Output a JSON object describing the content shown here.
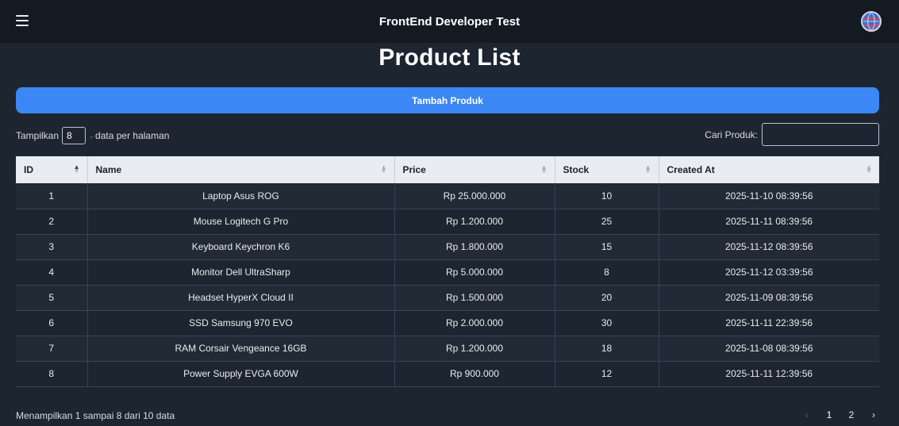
{
  "header": {
    "title": "FrontEnd Developer Test",
    "menu_icon": "hamburger-menu-icon",
    "avatar_icon": "globe-avatar-icon"
  },
  "page": {
    "title": "Product List",
    "add_button_label": "Tambah Produk"
  },
  "length_control": {
    "prefix": "Tampilkan",
    "value": "8",
    "suffix": "data per halaman"
  },
  "search": {
    "label": "Cari Produk:",
    "value": "",
    "placeholder": ""
  },
  "table": {
    "columns": [
      "ID",
      "Name",
      "Price",
      "Stock",
      "Created At"
    ],
    "sorted_column": "ID",
    "rows": [
      [
        "1",
        "Laptop Asus ROG",
        "Rp 25.000.000",
        "10",
        "2025-11-10 08:39:56"
      ],
      [
        "2",
        "Mouse Logitech G Pro",
        "Rp 1.200.000",
        "25",
        "2025-11-11 08:39:56"
      ],
      [
        "3",
        "Keyboard Keychron K6",
        "Rp 1.800.000",
        "15",
        "2025-11-12 08:39:56"
      ],
      [
        "4",
        "Monitor Dell UltraSharp",
        "Rp 5.000.000",
        "8",
        "2025-11-12 03:39:56"
      ],
      [
        "5",
        "Headset HyperX Cloud II",
        "Rp 1.500.000",
        "20",
        "2025-11-09 08:39:56"
      ],
      [
        "6",
        "SSD Samsung 970 EVO",
        "Rp 2.000.000",
        "30",
        "2025-11-11 22:39:56"
      ],
      [
        "7",
        "RAM Corsair Vengeance 16GB",
        "Rp 1.200.000",
        "18",
        "2025-11-08 08:39:56"
      ],
      [
        "8",
        "Power Supply EVGA 600W",
        "Rp 900.000",
        "12",
        "2025-11-11 12:39:56"
      ]
    ]
  },
  "footer": {
    "info": "Menampilkan 1 sampai 8 dari 10 data",
    "pagination": {
      "prev": "‹",
      "pages": [
        "1",
        "2"
      ],
      "current": "1",
      "next": "›"
    }
  },
  "colors": {
    "background": "#1d2530",
    "topbar": "#141a22",
    "accent": "#3b87f5",
    "table_header": "#e9ecf0"
  }
}
